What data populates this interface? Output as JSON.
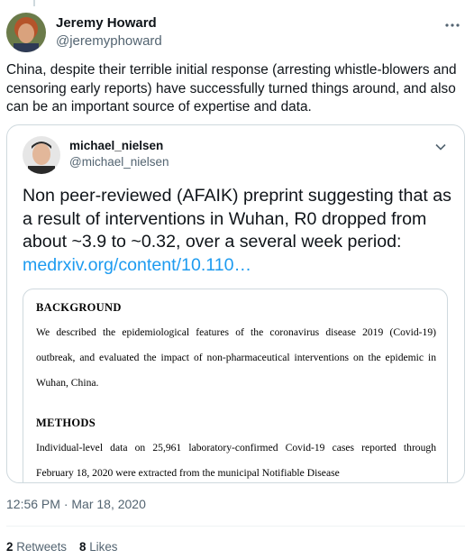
{
  "tweet": {
    "author": {
      "name": "Jeremy Howard",
      "handle": "@jeremyphoward"
    },
    "text": "China, despite their terrible initial response (arresting whistle-blowers and censoring early reports) have successfully turned things around, and also can be an important source of expertise and data.",
    "timestamp": "12:56 PM · Mar 18, 2020",
    "stats": {
      "retweets_count": "2",
      "retweets_label": "Retweets",
      "likes_count": "8",
      "likes_label": "Likes"
    }
  },
  "quoted": {
    "author": {
      "name": "michael_nielsen",
      "handle": "@michael_nielsen"
    },
    "text": "Non peer-reviewed (AFAIK) preprint suggesting that as a result of interventions in Wuhan, R0 dropped from about ~3.9 to ~0.32, over a several week period:",
    "link": "medrxiv.org/content/10.110…",
    "document": {
      "heading1": "BACKGROUND",
      "para1": "We described the epidemiological features of the coronavirus disease 2019 (Covid-19) outbreak, and evaluated the impact of non-pharmaceutical interventions on the epidemic in Wuhan, China.",
      "heading2": "METHODS",
      "para2": "Individual-level data on 25,961 laboratory-confirmed Covid-19 cases reported through February 18, 2020 were extracted from the municipal Notifiable Disease"
    }
  },
  "icons": {
    "more": "more-horizontal-icon",
    "chevron": "chevron-down-icon"
  },
  "colors": {
    "link": "#1d9bf0",
    "muted": "#536471",
    "text": "#0f1419",
    "border": "#cfd9de"
  }
}
